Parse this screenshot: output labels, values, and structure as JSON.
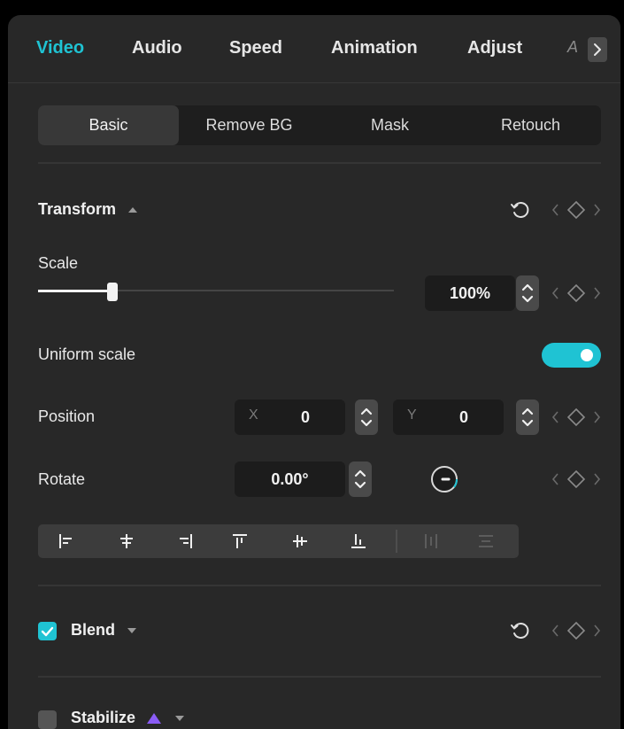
{
  "tabs": [
    {
      "label": "Video"
    },
    {
      "label": "Audio"
    },
    {
      "label": "Speed"
    },
    {
      "label": "Animation"
    },
    {
      "label": "Adjust"
    },
    {
      "label": "A"
    }
  ],
  "subtabs": [
    {
      "label": "Basic"
    },
    {
      "label": "Remove BG"
    },
    {
      "label": "Mask"
    },
    {
      "label": "Retouch"
    }
  ],
  "transform": {
    "title": "Transform",
    "scale": {
      "label": "Scale",
      "value": "100%",
      "slider_fraction": 0.2
    },
    "uniform_scale": {
      "label": "Uniform scale",
      "on": true
    },
    "position": {
      "label": "Position",
      "x_label": "X",
      "x": "0",
      "y_label": "Y",
      "y": "0"
    },
    "rotate": {
      "label": "Rotate",
      "value": "0.00°"
    }
  },
  "blend": {
    "title": "Blend",
    "checked": true
  },
  "stabilize": {
    "title": "Stabilize",
    "checked": false
  },
  "colors": {
    "accent": "#1fc3d3",
    "panel": "#282828",
    "field": "#1c1c1c"
  }
}
